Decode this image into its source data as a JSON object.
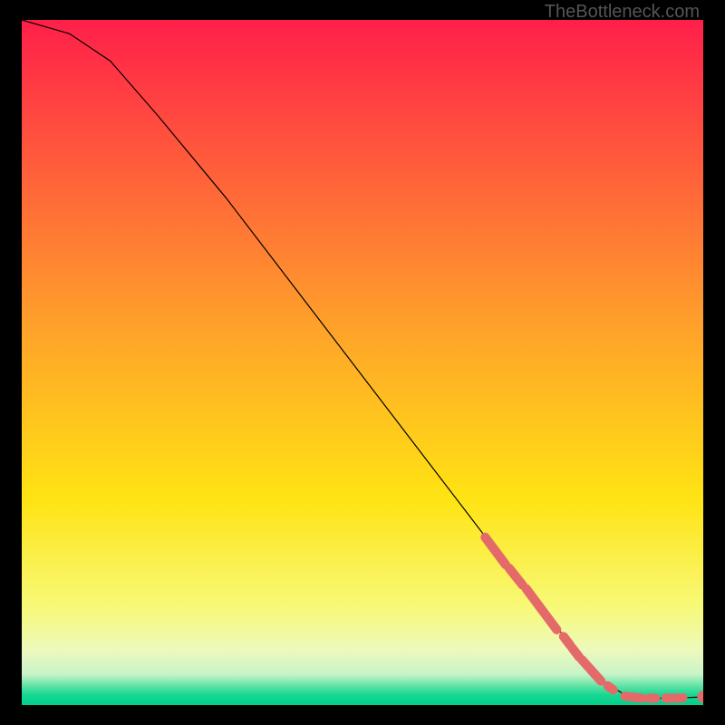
{
  "watermark": "TheBottleneck.com",
  "chart_data": {
    "type": "line",
    "title": "",
    "xlabel": "",
    "ylabel": "",
    "xlim": [
      0,
      100
    ],
    "ylim": [
      0,
      100
    ],
    "grid": false,
    "curve": [
      {
        "x": 0,
        "y": 100
      },
      {
        "x": 7,
        "y": 98
      },
      {
        "x": 13,
        "y": 94
      },
      {
        "x": 20,
        "y": 86
      },
      {
        "x": 30,
        "y": 74
      },
      {
        "x": 40,
        "y": 61
      },
      {
        "x": 50,
        "y": 48
      },
      {
        "x": 60,
        "y": 35
      },
      {
        "x": 70,
        "y": 22
      },
      {
        "x": 78,
        "y": 12
      },
      {
        "x": 82,
        "y": 7
      },
      {
        "x": 86,
        "y": 3
      },
      {
        "x": 89,
        "y": 1.2
      },
      {
        "x": 92,
        "y": 1.0
      },
      {
        "x": 96,
        "y": 1.0
      },
      {
        "x": 100,
        "y": 1.2
      }
    ],
    "highlighted_segments": [
      {
        "x0": 68,
        "y0": 24.5,
        "x1": 71,
        "y1": 20.5
      },
      {
        "x0": 71.5,
        "y0": 20.0,
        "x1": 73.5,
        "y1": 17.5
      },
      {
        "x0": 74.0,
        "y0": 17.0,
        "x1": 78.5,
        "y1": 11.0
      },
      {
        "x0": 79.5,
        "y0": 10.0,
        "x1": 80.5,
        "y1": 8.7
      },
      {
        "x0": 80.8,
        "y0": 8.3,
        "x1": 81.8,
        "y1": 7.0
      },
      {
        "x0": 82.2,
        "y0": 6.6,
        "x1": 85.0,
        "y1": 3.5
      },
      {
        "x0": 86.0,
        "y0": 2.8,
        "x1": 86.8,
        "y1": 2.2
      },
      {
        "x0": 88.5,
        "y0": 1.3,
        "x1": 91.0,
        "y1": 1.0
      },
      {
        "x0": 92.0,
        "y0": 1.0,
        "x1": 93.0,
        "y1": 1.0
      },
      {
        "x0": 94.5,
        "y0": 1.0,
        "x1": 95.5,
        "y1": 1.0
      },
      {
        "x0": 96.0,
        "y0": 1.0,
        "x1": 97.0,
        "y1": 1.05
      }
    ],
    "end_marker": {
      "x": 100,
      "y": 1.2
    },
    "background_gradient": [
      {
        "pos": 0.0,
        "color": "#ff1f4a"
      },
      {
        "pos": 0.45,
        "color": "#ffa22a"
      },
      {
        "pos": 0.7,
        "color": "#ffe413"
      },
      {
        "pos": 0.86,
        "color": "#f7f97a"
      },
      {
        "pos": 0.92,
        "color": "#edf9bd"
      },
      {
        "pos": 0.955,
        "color": "#c8f4c8"
      },
      {
        "pos": 0.975,
        "color": "#4fe0a0"
      },
      {
        "pos": 0.985,
        "color": "#18d893"
      },
      {
        "pos": 1.0,
        "color": "#00cf8a"
      }
    ],
    "marker_color": "#e46a6a",
    "curve_color": "#000000"
  }
}
